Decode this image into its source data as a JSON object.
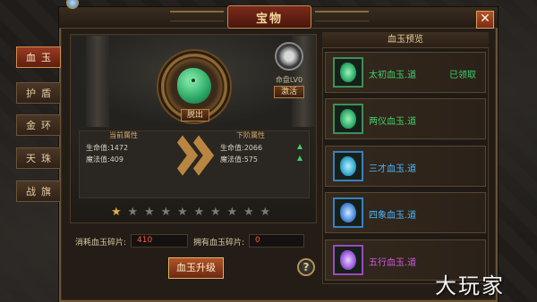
{
  "window": {
    "title": "宝物"
  },
  "tabs": [
    {
      "label": "血玉",
      "active": true
    },
    {
      "label": "护盾",
      "active": false
    },
    {
      "label": "金环",
      "active": false
    },
    {
      "label": "天珠",
      "active": false
    },
    {
      "label": "战旗",
      "active": false
    }
  ],
  "main": {
    "take_off_label": "脱出",
    "sub": {
      "label": "命盘LV0",
      "button": "激活"
    },
    "current": {
      "title": "当前属性",
      "hp": "生命值:1472",
      "mp": "魔法值:409"
    },
    "next": {
      "title": "下阶属性",
      "hp": "生命值:2066",
      "mp": "魔法值:575"
    },
    "stars": {
      "lit": 1,
      "total": 10
    },
    "cost_label": "消耗血玉碎片:",
    "cost_value": "410",
    "own_label": "拥有血玉碎片:",
    "own_value": "0",
    "upgrade_button": "血玉升级",
    "help_button": "?"
  },
  "preview": {
    "title": "血玉预览",
    "items": [
      {
        "name": "太初血玉.道",
        "status": "已领取",
        "color": "#3fd06a"
      },
      {
        "name": "两仪血玉.道",
        "status": "",
        "color": "#3fd06a"
      },
      {
        "name": "三才血玉.道",
        "status": "",
        "color": "#4ab8ff"
      },
      {
        "name": "四象血玉.道",
        "status": "",
        "color": "#4ab8ff"
      },
      {
        "name": "五行血玉.道",
        "status": "",
        "color": "#d05ae0"
      }
    ]
  },
  "watermark": "大玩家",
  "icons": {
    "close": "close-icon",
    "gem": "jade-dragon-icon"
  }
}
